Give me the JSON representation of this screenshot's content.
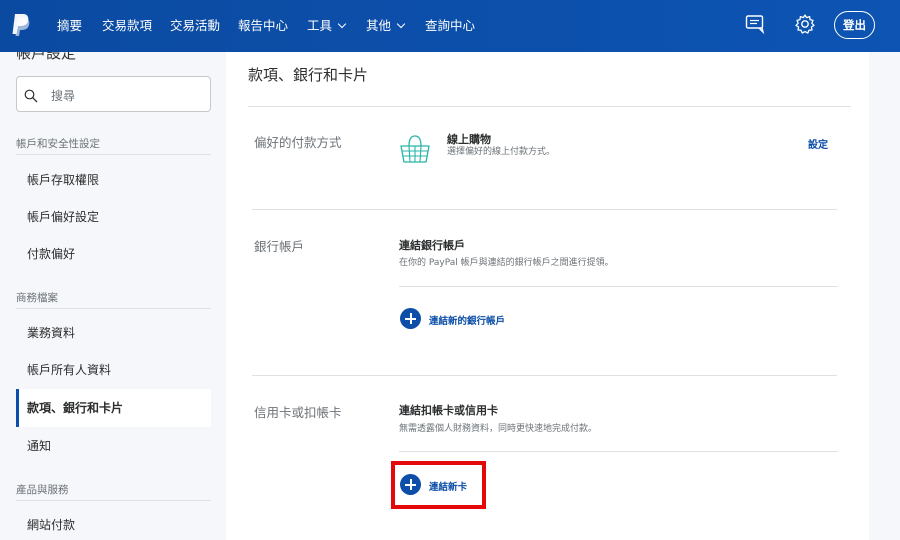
{
  "nav": {
    "items": [
      {
        "label": "摘要",
        "dropdown": false
      },
      {
        "label": "交易款項",
        "dropdown": false
      },
      {
        "label": "交易活動",
        "dropdown": false
      },
      {
        "label": "報告中心",
        "dropdown": false
      },
      {
        "label": "工具",
        "dropdown": true
      },
      {
        "label": "其他",
        "dropdown": true
      },
      {
        "label": "查詢中心",
        "dropdown": false
      }
    ],
    "logout_label": "登出",
    "icons": [
      "paypal-logo",
      "message-icon",
      "gear-icon"
    ],
    "colors": {
      "bar": "#0c4ea8"
    }
  },
  "sidebar": {
    "title": "帳戶設定",
    "search_placeholder": "搜尋",
    "section1": "帳戶和安全性設定",
    "item_access": "帳戶存取權限",
    "item_prefs": "帳戶偏好設定",
    "item_payprefs": "付款偏好",
    "section2": "商務檔案",
    "item_business": "業務資料",
    "item_owner": "帳戶所有人資料",
    "item_banks": "款項、銀行和卡片",
    "item_notify": "通知",
    "section3": "產品與服務",
    "item_website": "網站付款"
  },
  "main": {
    "title": "款項、銀行和卡片",
    "preferred": {
      "label": "偏好的付款方式",
      "item_title": "線上購物",
      "item_desc": "選擇偏好的線上付款方式。",
      "action": "設定"
    },
    "bank": {
      "label": "銀行帳戶",
      "item_title": "連結銀行帳戶",
      "item_desc": "在你的 PayPal 帳戶與連結的銀行帳戶之間進行提領。",
      "add": "連結新的銀行帳戶"
    },
    "card": {
      "label": "信用卡或扣帳卡",
      "item_title": "連結扣帳卡或信用卡",
      "item_desc": "無需透露個人財務資料，同時更快速地完成付款。",
      "add": "連結新卡"
    },
    "colors": {
      "link": "#0c4ea8",
      "highlight": "#e4080a"
    }
  }
}
